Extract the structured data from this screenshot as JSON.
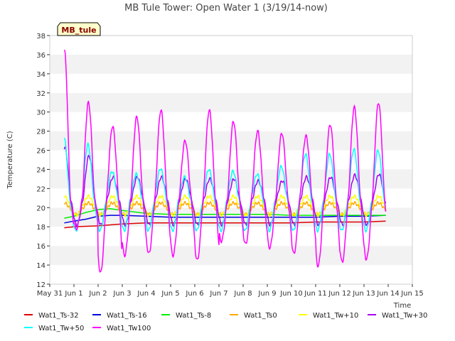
{
  "chart_data": {
    "type": "line",
    "title": "MB Tule Tower: Open Water 1 (3/19/14-now)",
    "xlabel": "Time",
    "ylabel": "Temperature (C)",
    "xlim": [
      0,
      15
    ],
    "ylim": [
      12,
      38
    ],
    "yticks": [
      12,
      14,
      16,
      18,
      20,
      22,
      24,
      26,
      28,
      30,
      32,
      34,
      36,
      38
    ],
    "xticks": [
      0,
      1,
      2,
      3,
      4,
      5,
      6,
      7,
      8,
      9,
      10,
      11,
      12,
      13,
      14,
      15
    ],
    "xtick_labels": [
      "May 31",
      "Jun 1",
      "Jun 2",
      "Jun 3",
      "Jun 4",
      "Jun 5",
      "Jun 6",
      "Jun 7",
      "Jun 8",
      "Jun 9",
      "Jun 10",
      "Jun 11",
      "Jun 12",
      "Jun 13",
      "Jun 14",
      "Jun 15"
    ],
    "grid": "horizontal bands",
    "legend_position": "bottom",
    "station_label": "MB_tule",
    "series": [
      {
        "name": "Wat1_Ts-32",
        "color": "#dd0000",
        "x": [
          0.6,
          1,
          2,
          3,
          4,
          5,
          6,
          7,
          8,
          9,
          10,
          11,
          12,
          13,
          13.9
        ],
        "y": [
          17.9,
          18.0,
          18.1,
          18.3,
          18.4,
          18.4,
          18.4,
          18.4,
          18.4,
          18.4,
          18.4,
          18.5,
          18.5,
          18.5,
          18.6
        ]
      },
      {
        "name": "Wat1_Ts-16",
        "color": "#0000dd",
        "x": [
          0.6,
          1,
          1.5,
          2,
          2.5,
          3,
          4,
          5,
          6,
          7,
          8,
          9,
          10,
          11,
          12,
          13,
          13.9
        ],
        "y": [
          18.4,
          18.6,
          18.8,
          19.1,
          19.2,
          19.2,
          19.1,
          19.0,
          19.0,
          19.0,
          19.0,
          19.0,
          19.0,
          19.0,
          19.1,
          19.1,
          19.2
        ]
      },
      {
        "name": "Wat1_Ts-8",
        "color": "#00ee00",
        "x": [
          0.6,
          1,
          1.5,
          2,
          2.5,
          3,
          4,
          5,
          6,
          7,
          8,
          9,
          10,
          11,
          12,
          13,
          13.9
        ],
        "y": [
          18.9,
          19.1,
          19.5,
          19.8,
          19.9,
          19.7,
          19.4,
          19.3,
          19.3,
          19.3,
          19.3,
          19.3,
          19.2,
          19.2,
          19.2,
          19.2,
          19.2
        ]
      },
      {
        "name": "Wat1_Ts0",
        "color": "#ffaa00",
        "mean": 19.9,
        "amplitude": 0.6,
        "phase": 0.6
      },
      {
        "name": "Wat1_Tw+10",
        "color": "#ffff00",
        "mean": 20.2,
        "amplitude": 1.0,
        "phase": 0.6
      },
      {
        "name": "Wat1_Tw+30",
        "color": "#aa00ee",
        "mean": 20.8,
        "amplitude": 2.6,
        "phase": 0.62,
        "daily_peak": [
          26.3,
          25.4,
          23.2,
          23.2,
          23.2,
          23.0,
          23.0,
          23.0,
          22.8,
          22.8,
          23.2,
          23.2,
          23.4,
          23.5
        ]
      },
      {
        "name": "Wat1_Tw+50",
        "color": "#00ffff",
        "mean": 20.8,
        "amplitude": 3.2,
        "phase": 0.58,
        "daily_peak": [
          27.5,
          26.6,
          23.8,
          23.5,
          24.1,
          23.2,
          24.0,
          23.8,
          23.5,
          24.3,
          25.6,
          25.6,
          26.1,
          26.0
        ]
      },
      {
        "name": "Wat1_Tw100",
        "color": "#ff00ff",
        "mean": 21.0,
        "amplitude": 6.0,
        "phase": 0.6,
        "daily_peak": [
          36.6,
          31.0,
          28.5,
          29.5,
          30.2,
          27.0,
          30.2,
          29.0,
          28.0,
          27.8,
          27.5,
          28.7,
          30.5,
          31.0
        ],
        "daily_min": [
          17.2,
          17.8,
          13.2,
          15.0,
          15.2,
          15.0,
          14.5,
          16.5,
          16.2,
          15.8,
          15.2,
          13.9,
          14.3,
          14.6
        ]
      }
    ]
  }
}
